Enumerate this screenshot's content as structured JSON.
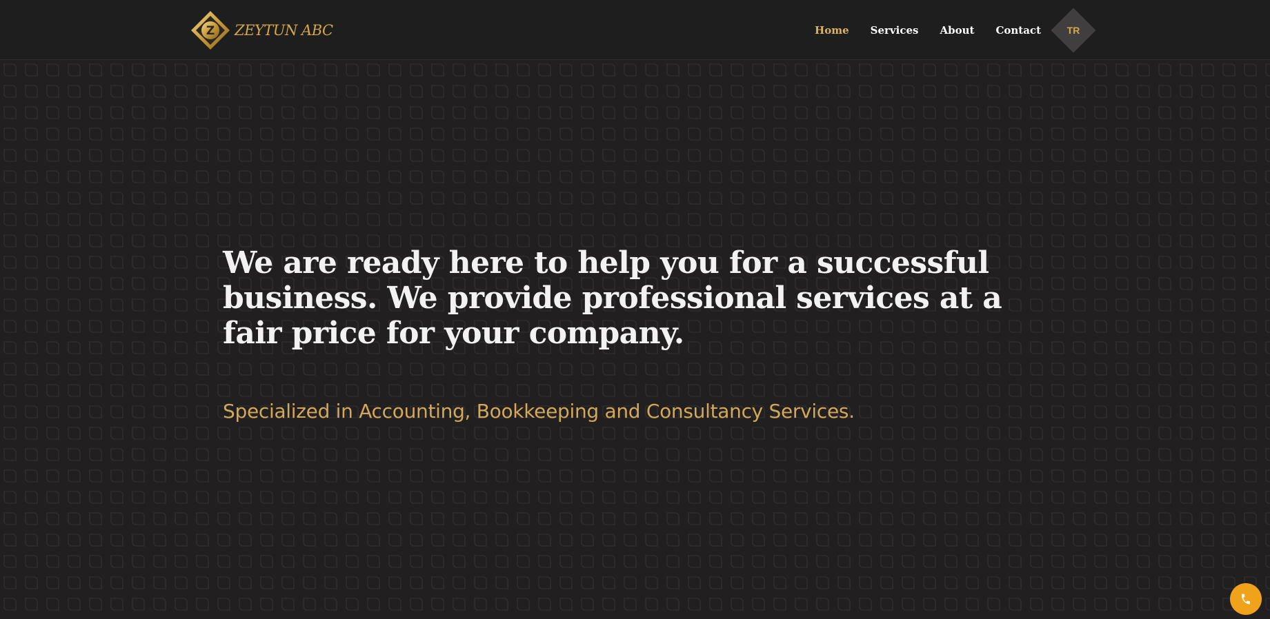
{
  "brand": {
    "name": "ZEYTUN ABC",
    "mark_letter": "Z",
    "gold": "#d4a84a",
    "background": "#211f20"
  },
  "nav": {
    "items": [
      {
        "label": "Home",
        "active": true
      },
      {
        "label": "Services",
        "active": false
      },
      {
        "label": "About",
        "active": false
      },
      {
        "label": "Contact",
        "active": false
      }
    ],
    "language": "TR"
  },
  "hero": {
    "title": "We are ready here to help you for a successful business. We provide professional services at a fair price for your company.",
    "subtitle": "Specialized in Accounting, Bookkeeping and Consultancy Services."
  },
  "floating": {
    "icon": "phone-icon",
    "color": "#f0a31a"
  }
}
